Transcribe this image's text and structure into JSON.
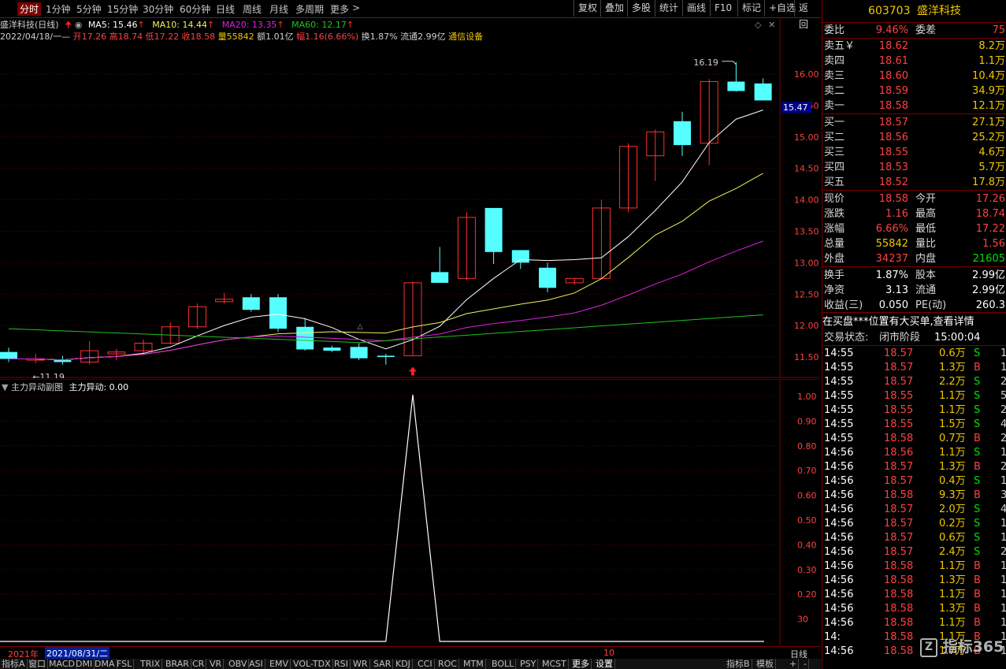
{
  "toolbar": {
    "periods": [
      "分时",
      "1分钟",
      "5分钟",
      "15分钟",
      "30分钟",
      "60分钟",
      "日线",
      "周线",
      "月线",
      "多周期",
      "更多"
    ],
    "active_period": "分时",
    "right_buttons": [
      "复权",
      "叠加",
      "多股",
      "统计",
      "画线",
      "F10",
      "标记",
      "+自选",
      "返回"
    ]
  },
  "stock": {
    "code": "603703",
    "name": "盛洋科技",
    "title": "盛洋科技(日线)"
  },
  "ma": {
    "ma5": "MA5: 15.46",
    "ma10": "MA10: 14.44",
    "ma20": "MA20: 13.35",
    "ma60": "MA60: 12.17"
  },
  "info": {
    "date": "2022/04/18/一",
    "open": "开17.26",
    "high": "高18.74",
    "low": "低17.22",
    "close": "收18.58",
    "volume": "量55842",
    "amount": "额1.01亿",
    "change": "幅1.16(6.66%)",
    "turnover": "换1.87%",
    "float": "流通2.99亿",
    "industry": "通信设备"
  },
  "main_chart": {
    "y_ticks": [
      "16.00",
      "15.50",
      "15.00",
      "14.50",
      "14.00",
      "13.50",
      "13.00",
      "12.50",
      "12.00",
      "11.50"
    ],
    "price_badge": "15.47",
    "high_label": "16.19",
    "low_label": "11.19",
    "colors": {
      "up": "#ff3030",
      "down": "#55ffff",
      "ma5": "#ffffff",
      "ma10": "#f0f060",
      "ma20": "#e020e0",
      "ma60": "#20c020"
    }
  },
  "chart_data": {
    "type": "candlestick",
    "ohlc": [
      [
        11.58,
        11.65,
        11.42,
        11.47
      ],
      [
        11.45,
        11.55,
        11.4,
        11.47
      ],
      [
        11.45,
        11.52,
        11.38,
        11.42
      ],
      [
        11.42,
        11.75,
        11.38,
        11.6
      ],
      [
        11.55,
        11.63,
        11.45,
        11.58
      ],
      [
        11.6,
        11.78,
        11.55,
        11.72
      ],
      [
        11.72,
        12.05,
        11.7,
        11.98
      ],
      [
        11.98,
        12.35,
        11.95,
        12.3
      ],
      [
        12.38,
        12.52,
        12.35,
        12.42
      ],
      [
        12.45,
        12.5,
        12.22,
        12.25
      ],
      [
        12.45,
        12.5,
        11.9,
        11.95
      ],
      [
        11.98,
        12.12,
        11.6,
        11.62
      ],
      [
        11.65,
        11.68,
        11.58,
        11.6
      ],
      [
        11.66,
        11.72,
        11.45,
        11.48
      ],
      [
        11.52,
        11.55,
        11.38,
        11.5
      ],
      [
        11.52,
        12.7,
        11.52,
        12.68
      ],
      [
        12.85,
        13.25,
        12.68,
        12.68
      ],
      [
        12.75,
        13.8,
        12.72,
        13.72
      ],
      [
        13.87,
        13.87,
        12.98,
        13.17
      ],
      [
        13.2,
        13.2,
        12.9,
        13.0
      ],
      [
        12.92,
        13.0,
        12.53,
        12.6
      ],
      [
        12.68,
        12.75,
        12.65,
        12.75
      ],
      [
        12.75,
        14.0,
        12.75,
        13.87
      ],
      [
        13.87,
        14.9,
        13.8,
        14.85
      ],
      [
        14.7,
        15.12,
        14.3,
        15.08
      ],
      [
        15.25,
        15.4,
        14.7,
        14.87
      ],
      [
        14.9,
        15.92,
        14.55,
        15.88
      ],
      [
        15.88,
        16.19,
        15.72,
        15.73
      ],
      [
        15.85,
        15.93,
        15.58,
        15.58
      ]
    ],
    "ma_values": {
      "MA5": 15.46,
      "MA10": 14.44,
      "MA20": 13.35,
      "MA60": 12.17
    },
    "ylim": [
      11.2,
      16.25
    ],
    "indicator": {
      "name": "主力异动副图",
      "series": "主力异动",
      "current": "0.00",
      "values": [
        0,
        0,
        0,
        0,
        0,
        0,
        0,
        0,
        0,
        0,
        0,
        0,
        0,
        0,
        0,
        1,
        0,
        0,
        0,
        0,
        0,
        0,
        0,
        0,
        0,
        0,
        0,
        0,
        0
      ],
      "y_ticks": [
        "1.00",
        "0.90",
        "0.80",
        "0.70",
        "0.60",
        "0.50",
        "0.40",
        "0.30",
        "0.20",
        "30"
      ],
      "ylim": [
        0,
        1
      ]
    }
  },
  "sub_chart": {
    "label": "主力异动副图",
    "value_label": "主力异动: 0.00"
  },
  "date_bar": {
    "year": "2021年",
    "date": "2021/08/31/二",
    "month": "10",
    "right": "日线"
  },
  "tabs": [
    "指标A",
    "窗口",
    "MACD",
    "DMI",
    "DMA",
    "FSL",
    "TRIX",
    "BRAR",
    "CR",
    "VR",
    "OBV",
    "ASI",
    "EMV",
    "VOL-TDX",
    "RSI",
    "WR",
    "SAR",
    "KDJ",
    "CCI",
    "ROC",
    "MTM",
    "BOLL",
    "PSY",
    "MCST",
    "更多",
    "设置",
    "指标B",
    "模板"
  ],
  "panel": {
    "weibi": {
      "label": "委比",
      "value": "9.46%",
      "label2": "委差",
      "value2": "75"
    },
    "sell": [
      {
        "label": "卖五￥",
        "price": "18.62",
        "vol": "8.2万"
      },
      {
        "label": "卖四",
        "price": "18.61",
        "vol": "1.1万"
      },
      {
        "label": "卖三",
        "price": "18.60",
        "vol": "10.4万"
      },
      {
        "label": "卖二",
        "price": "18.59",
        "vol": "34.9万"
      },
      {
        "label": "卖一",
        "price": "18.58",
        "vol": "12.1万"
      }
    ],
    "buy": [
      {
        "label": "买一",
        "price": "18.57",
        "vol": "27.1万"
      },
      {
        "label": "买二",
        "price": "18.56",
        "vol": "25.2万"
      },
      {
        "label": "买三",
        "price": "18.55",
        "vol": "4.6万"
      },
      {
        "label": "买四",
        "price": "18.53",
        "vol": "5.7万"
      },
      {
        "label": "买五",
        "price": "18.52",
        "vol": "17.8万"
      }
    ],
    "quote": [
      {
        "l1": "现价",
        "v1": "18.58",
        "c1": "red",
        "l2": "今开",
        "v2": "17.26",
        "c2": "red"
      },
      {
        "l1": "涨跌",
        "v1": "1.16",
        "c1": "red",
        "l2": "最高",
        "v2": "18.74",
        "c2": "red"
      },
      {
        "l1": "涨幅",
        "v1": "6.66%",
        "c1": "red",
        "l2": "最低",
        "v2": "17.22",
        "c2": "red"
      },
      {
        "l1": "总量",
        "v1": "55842",
        "c1": "yellow",
        "l2": "量比",
        "v2": "1.56",
        "c2": "red"
      },
      {
        "l1": "外盘",
        "v1": "34237",
        "c1": "red",
        "l2": "内盘",
        "v2": "21605",
        "c2": "green"
      }
    ],
    "fund": [
      {
        "l1": "换手",
        "v1": "1.87%",
        "l2": "股本",
        "v2": "2.99亿"
      },
      {
        "l1": "净资",
        "v1": "3.13",
        "l2": "流通",
        "v2": "2.99亿"
      },
      {
        "l1": "收益(三)",
        "v1": "0.050",
        "l2": "PE(动)",
        "v2": "260.3"
      }
    ],
    "notice": "在买盘***位置有大买单,查看详情",
    "status_label": "交易状态:",
    "status_value": "闭市阶段",
    "status_time": "15:00:04",
    "ticks": [
      {
        "t": "14:55",
        "p": "18.57",
        "v": "0.6万",
        "d": "S",
        "n": "1"
      },
      {
        "t": "14:55",
        "p": "18.57",
        "v": "1.3万",
        "d": "B",
        "n": "1"
      },
      {
        "t": "14:55",
        "p": "18.57",
        "v": "2.2万",
        "d": "S",
        "n": "2"
      },
      {
        "t": "14:55",
        "p": "18.55",
        "v": "1.1万",
        "d": "S",
        "n": "5"
      },
      {
        "t": "14:55",
        "p": "18.55",
        "v": "1.1万",
        "d": "S",
        "n": "2"
      },
      {
        "t": "14:55",
        "p": "18.55",
        "v": "1.5万",
        "d": "S",
        "n": "4"
      },
      {
        "t": "14:55",
        "p": "18.58",
        "v": "0.7万",
        "d": "B",
        "n": "2"
      },
      {
        "t": "14:56",
        "p": "18.56",
        "v": "1.1万",
        "d": "S",
        "n": "1"
      },
      {
        "t": "14:56",
        "p": "18.57",
        "v": "1.3万",
        "d": "B",
        "n": "2"
      },
      {
        "t": "14:56",
        "p": "18.57",
        "v": "0.4万",
        "d": "S",
        "n": "1"
      },
      {
        "t": "14:56",
        "p": "18.58",
        "v": "9.3万",
        "d": "B",
        "n": "3"
      },
      {
        "t": "14:56",
        "p": "18.57",
        "v": "2.0万",
        "d": "S",
        "n": "4"
      },
      {
        "t": "14:56",
        "p": "18.57",
        "v": "0.2万",
        "d": "S",
        "n": "1"
      },
      {
        "t": "14:56",
        "p": "18.57",
        "v": "0.6万",
        "d": "S",
        "n": "1"
      },
      {
        "t": "14:56",
        "p": "18.57",
        "v": "2.4万",
        "d": "S",
        "n": "2"
      },
      {
        "t": "14:56",
        "p": "18.58",
        "v": "1.1万",
        "d": "B",
        "n": "1"
      },
      {
        "t": "14:56",
        "p": "18.58",
        "v": "1.3万",
        "d": "B",
        "n": "1"
      },
      {
        "t": "14:56",
        "p": "18.58",
        "v": "1.1万",
        "d": "B",
        "n": "1"
      },
      {
        "t": "14:56",
        "p": "18.58",
        "v": "1.3万",
        "d": "B",
        "n": "1"
      },
      {
        "t": "14:56",
        "p": "18.58",
        "v": "1.1万",
        "d": "B",
        "n": "1"
      },
      {
        "t": "14:",
        "p": "18.58",
        "v": "1.1万",
        "d": "B",
        "n": "1"
      },
      {
        "t": "14:56",
        "p": "18.58",
        "v": "1.7万",
        "d": "B",
        "n": "1"
      }
    ]
  },
  "watermark": "指标365"
}
